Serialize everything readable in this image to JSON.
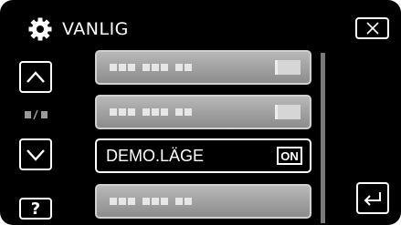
{
  "header": {
    "title": "VANLIG",
    "icon": "gear-icon"
  },
  "nav": {
    "close_icon": "close-icon",
    "up_icon": "chevron-up-icon",
    "down_icon": "chevron-down-icon",
    "page_indicator_icon": "page-indicator-icon",
    "help_label": "?",
    "back_icon": "return-icon"
  },
  "menu": {
    "items": [
      {
        "label": "",
        "value": ""
      },
      {
        "label": "",
        "value": ""
      },
      {
        "label": "DEMO.LÄGE",
        "value": "ON",
        "selected": true
      },
      {
        "label": "",
        "value": ""
      }
    ]
  },
  "colors": {
    "background": "#000000",
    "item_fill": "#a0a0a0",
    "text": "#ffffff"
  }
}
